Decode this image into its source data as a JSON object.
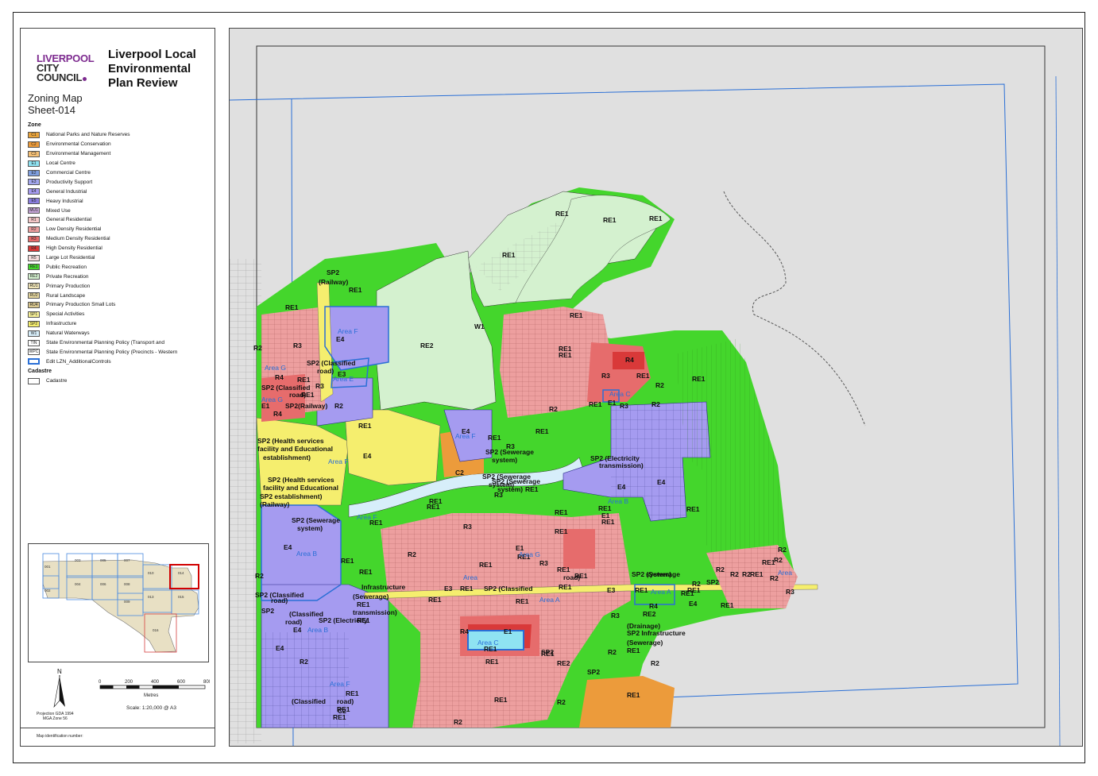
{
  "header": {
    "logo_line1": "LIVERPOOL",
    "logo_line2": "CITY",
    "logo_line3": "COUNCIL",
    "title_line1": "Liverpool Local",
    "title_line2": "Environmental",
    "title_line3": "Plan Review",
    "map_name": "Zoning Map",
    "sheet": "Sheet-014"
  },
  "legend": {
    "zone_heading": "Zone",
    "cadastre_heading": "Cadastre",
    "zones": [
      {
        "code": "C1",
        "label": "National Parks and Nature Reserves",
        "color": "#e8a33a"
      },
      {
        "code": "C2",
        "label": "Environmental Conservation",
        "color": "#ec9b3b"
      },
      {
        "code": "C3",
        "label": "Environmental Management",
        "color": "#f5c076"
      },
      {
        "code": "E1",
        "label": "Local Centre",
        "color": "#8fe3f2"
      },
      {
        "code": "E2",
        "label": "Commercial Centre",
        "color": "#7f9fe0"
      },
      {
        "code": "E3",
        "label": "Productivity Support",
        "color": "#a3a7ef"
      },
      {
        "code": "E4",
        "label": "General Industrial",
        "color": "#a59bf0"
      },
      {
        "code": "E5",
        "label": "Heavy Industrial",
        "color": "#8a7ee0"
      },
      {
        "code": "MU1",
        "label": "Mixed Use",
        "color": "#c6a6d8"
      },
      {
        "code": "R1",
        "label": "General Residential",
        "color": "#f5c9c9"
      },
      {
        "code": "R2",
        "label": "Low Density Residential",
        "color": "#ed9f9f"
      },
      {
        "code": "R3",
        "label": "Medium Density Residential",
        "color": "#e66c6c"
      },
      {
        "code": "R4",
        "label": "High Density Residential",
        "color": "#d93939"
      },
      {
        "code": "R5",
        "label": "Large Lot Residential",
        "color": "#f7dede"
      },
      {
        "code": "RE1",
        "label": "Public Recreation",
        "color": "#44d62c"
      },
      {
        "code": "RE2",
        "label": "Private Recreation",
        "color": "#d4f1cf"
      },
      {
        "code": "RU1",
        "label": "Primary Production",
        "color": "#efe4b6"
      },
      {
        "code": "RU2",
        "label": "Rural Landscape",
        "color": "#e6d79e"
      },
      {
        "code": "RU4",
        "label": "Primary Production Small Lots",
        "color": "#dcc98f"
      },
      {
        "code": "SP1",
        "label": "Special Activities",
        "color": "#f7f098"
      },
      {
        "code": "SP2",
        "label": "Infrastructure",
        "color": "#f5ee6e"
      },
      {
        "code": "W1",
        "label": "Natural Waterways",
        "color": "#d7eefa"
      },
      {
        "code": "TIN",
        "label": "State Environmental Planning Policy (Transport and",
        "color": "#ffffff"
      },
      {
        "code": "WPC",
        "label": "State Environmental Planning Policy (Precincts - Western",
        "color": "#ffffff"
      },
      {
        "code": "",
        "label": "Edit LZN_AdditionalControls",
        "color": "#2a6fd6"
      }
    ],
    "cadastre_label": "Cadastre"
  },
  "keymap": {
    "sheets": [
      "001",
      "002",
      "003",
      "004",
      "005",
      "006",
      "007",
      "008",
      "009",
      "010",
      "013",
      "014",
      "015",
      "016"
    ]
  },
  "scale": {
    "ticks": [
      "0",
      "200",
      "400",
      "600",
      "800"
    ],
    "unit": "Metres",
    "text": "Scale: 1:20,000 @ A3",
    "north": "N",
    "projection_line1": "Projection GDA 1994",
    "projection_line2": "MGA Zone 56"
  },
  "footer": {
    "map_id_label": "Map identification number:"
  },
  "map_labels": {
    "zones": [
      {
        "t": "RE1"
      },
      {
        "t": "RE1"
      },
      {
        "t": "RE1"
      },
      {
        "t": "RE1"
      },
      {
        "t": "SP2"
      },
      {
        "t": "(Railway)"
      },
      {
        "t": "RE1"
      },
      {
        "t": "RE1"
      },
      {
        "t": "W1"
      },
      {
        "t": "RE1"
      },
      {
        "t": "E4"
      },
      {
        "t": "R3"
      },
      {
        "t": "R2"
      },
      {
        "t": "RE2"
      },
      {
        "t": "RE1"
      },
      {
        "t": "RE1"
      },
      {
        "t": "R4"
      },
      {
        "t": "RE1"
      },
      {
        "t": "R3"
      },
      {
        "t": "R2"
      },
      {
        "t": "RE1"
      },
      {
        "t": "SP2 (Classified"
      },
      {
        "t": "road)"
      },
      {
        "t": "R4"
      },
      {
        "t": "RE1"
      },
      {
        "t": "R3"
      },
      {
        "t": "E3"
      },
      {
        "t": "SP2 (Classified"
      },
      {
        "t": "road)"
      },
      {
        "t": "RE1"
      },
      {
        "t": "E1"
      },
      {
        "t": "SP2"
      },
      {
        "t": "(Railway)"
      },
      {
        "t": "R2"
      },
      {
        "t": "R4"
      },
      {
        "t": "R2"
      },
      {
        "t": "RE1"
      },
      {
        "t": "R3"
      },
      {
        "t": "R2"
      },
      {
        "t": "RE1"
      },
      {
        "t": "E1"
      },
      {
        "t": "RE1"
      },
      {
        "t": "E4"
      },
      {
        "t": "RE1"
      },
      {
        "t": "SP2 (Health services"
      },
      {
        "t": "facility and Educational"
      },
      {
        "t": "establishment)"
      },
      {
        "t": "E4"
      },
      {
        "t": "R3"
      },
      {
        "t": "SP2 (Sewerage"
      },
      {
        "t": "system)"
      },
      {
        "t": "SP2 (Electricity"
      },
      {
        "t": "transmission)"
      },
      {
        "t": "C2"
      },
      {
        "t": "SP2 (Sewerage"
      },
      {
        "t": "system)"
      },
      {
        "t": "SP2 (Sewerage"
      },
      {
        "t": "system)"
      },
      {
        "t": "RE1"
      },
      {
        "t": "E4"
      },
      {
        "t": "E4"
      },
      {
        "t": "SP2 (Health services"
      },
      {
        "t": "facility and Educational"
      },
      {
        "t": "SP2  establishment)"
      },
      {
        "t": "(Railway)"
      },
      {
        "t": "R3"
      },
      {
        "t": "RE1"
      },
      {
        "t": "RE1"
      },
      {
        "t": "RE1"
      },
      {
        "t": "RE1"
      },
      {
        "t": "RE1"
      },
      {
        "t": "E1"
      },
      {
        "t": "RE1"
      },
      {
        "t": "SP2 (Sewerage"
      },
      {
        "t": "system)"
      },
      {
        "t": "RE1"
      },
      {
        "t": "R3"
      },
      {
        "t": "RE1"
      },
      {
        "t": "E4"
      },
      {
        "t": "R2"
      },
      {
        "t": "E1"
      },
      {
        "t": "RE1"
      },
      {
        "t": "R3"
      },
      {
        "t": "R2"
      },
      {
        "t": "R2"
      },
      {
        "t": "RE1"
      },
      {
        "t": "RE1"
      },
      {
        "t": "RE1"
      },
      {
        "t": "RE1"
      },
      {
        "t": "RE1"
      },
      {
        "t": "SP2 (Sewerage"
      },
      {
        "t": "system)"
      },
      {
        "t": "R2"
      },
      {
        "t": "R2"
      },
      {
        "t": "R2"
      },
      {
        "t": "R2"
      },
      {
        "t": "RE1"
      },
      {
        "t": "RE1"
      },
      {
        "t": "R2"
      },
      {
        "t": "SP2"
      },
      {
        "t": "Infrastructure"
      },
      {
        "t": "(Sewerage)"
      },
      {
        "t": "RE1"
      },
      {
        "t": "E3"
      },
      {
        "t": "RE1"
      },
      {
        "t": "SP2 (Classified"
      },
      {
        "t": "road)"
      },
      {
        "t": "RE1"
      },
      {
        "t": "E3"
      },
      {
        "t": "RE1"
      },
      {
        "t": "R2"
      },
      {
        "t": "RE1"
      },
      {
        "t": "RE1"
      },
      {
        "t": "E4"
      },
      {
        "t": "SP2 (Classified"
      },
      {
        "t": "road)"
      },
      {
        "t": "SP2"
      },
      {
        "t": "(Classified"
      },
      {
        "t": "road)"
      },
      {
        "t": "E4"
      },
      {
        "t": "SP2 (Electricity"
      },
      {
        "t": "transmission)"
      },
      {
        "t": "RE1"
      },
      {
        "t": "RE1"
      },
      {
        "t": "RE1"
      },
      {
        "t": "R3"
      },
      {
        "t": "RE2"
      },
      {
        "t": "R4"
      },
      {
        "t": "R4"
      },
      {
        "t": "E1"
      },
      {
        "t": "RE1"
      },
      {
        "t": "SP2"
      },
      {
        "t": "(Drainage)"
      },
      {
        "t": "SP2 Infrastructure"
      },
      {
        "t": "(Sewerage)"
      },
      {
        "t": "RE1"
      },
      {
        "t": "R2"
      },
      {
        "t": "RE1"
      },
      {
        "t": "R3"
      },
      {
        "t": "RE1"
      },
      {
        "t": "RE1"
      },
      {
        "t": "RE2"
      },
      {
        "t": "R2"
      },
      {
        "t": "E4"
      },
      {
        "t": "RE1"
      },
      {
        "t": "R2"
      },
      {
        "t": "SP2"
      },
      {
        "t": "(Classified"
      },
      {
        "t": "road)"
      },
      {
        "t": "RE1"
      },
      {
        "t": "RE1"
      },
      {
        "t": "C2"
      },
      {
        "t": "RE1"
      },
      {
        "t": "R2"
      },
      {
        "t": "RE1"
      },
      {
        "t": "R2"
      }
    ],
    "areas": [
      {
        "t": "Area F"
      },
      {
        "t": "Area G"
      },
      {
        "t": "Area E"
      },
      {
        "t": "Area G"
      },
      {
        "t": "Area F"
      },
      {
        "t": "Area F"
      },
      {
        "t": "Area C"
      },
      {
        "t": "Area F"
      },
      {
        "t": "Area B"
      },
      {
        "t": "Area B"
      },
      {
        "t": "Area G"
      },
      {
        "t": "Area"
      },
      {
        "t": "Area A"
      },
      {
        "t": "Area B"
      },
      {
        "t": "Area C"
      },
      {
        "t": "Area F"
      },
      {
        "t": "Area A"
      },
      {
        "t": "Area"
      }
    ]
  }
}
